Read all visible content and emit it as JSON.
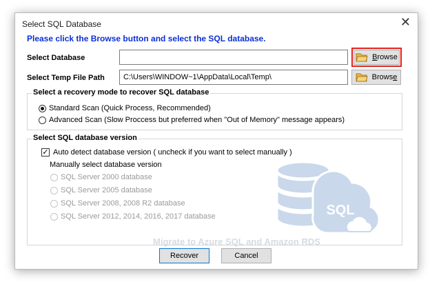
{
  "window": {
    "title": "Select SQL Database"
  },
  "instruction": "Please click the Browse button and select the SQL database.",
  "select_database": {
    "label": "Select Database",
    "value": ""
  },
  "temp_path": {
    "label": "Select Temp File Path",
    "value": "C:\\Users\\WINDOW~1\\AppData\\Local\\Temp\\"
  },
  "browse": {
    "label_first": "B",
    "label_rest": "rowse",
    "label2_main": "Brows",
    "label2_u": "e"
  },
  "recovery_mode": {
    "title": "Select a recovery mode to recover SQL database",
    "options": [
      {
        "label": "Standard Scan (Quick Process, Recommended)",
        "selected": true
      },
      {
        "label": "Advanced Scan (Slow Proccess but preferred when \"Out of Memory\" message appears)",
        "selected": false
      }
    ]
  },
  "version": {
    "title": "Select SQL database version",
    "auto_detect": "Auto detect database version ( uncheck if you want to select manually )",
    "auto_checked": true,
    "manual_label": "Manually select database version",
    "options": [
      "SQL Server 2000 database",
      "SQL Server 2005 database",
      "SQL Server 2008, 2008 R2 database",
      "SQL Server 2012, 2014, 2016, 2017 database"
    ]
  },
  "watermark": "Migrate to Azure SQL and Amazon RDS",
  "sql_icon_text": "SQL",
  "buttons": {
    "recover": "Recover",
    "cancel": "Cancel"
  },
  "colors": {
    "instruction": "#0b2fd6",
    "highlight": "#e2211c",
    "icon_blue": "#c9d8ea"
  }
}
